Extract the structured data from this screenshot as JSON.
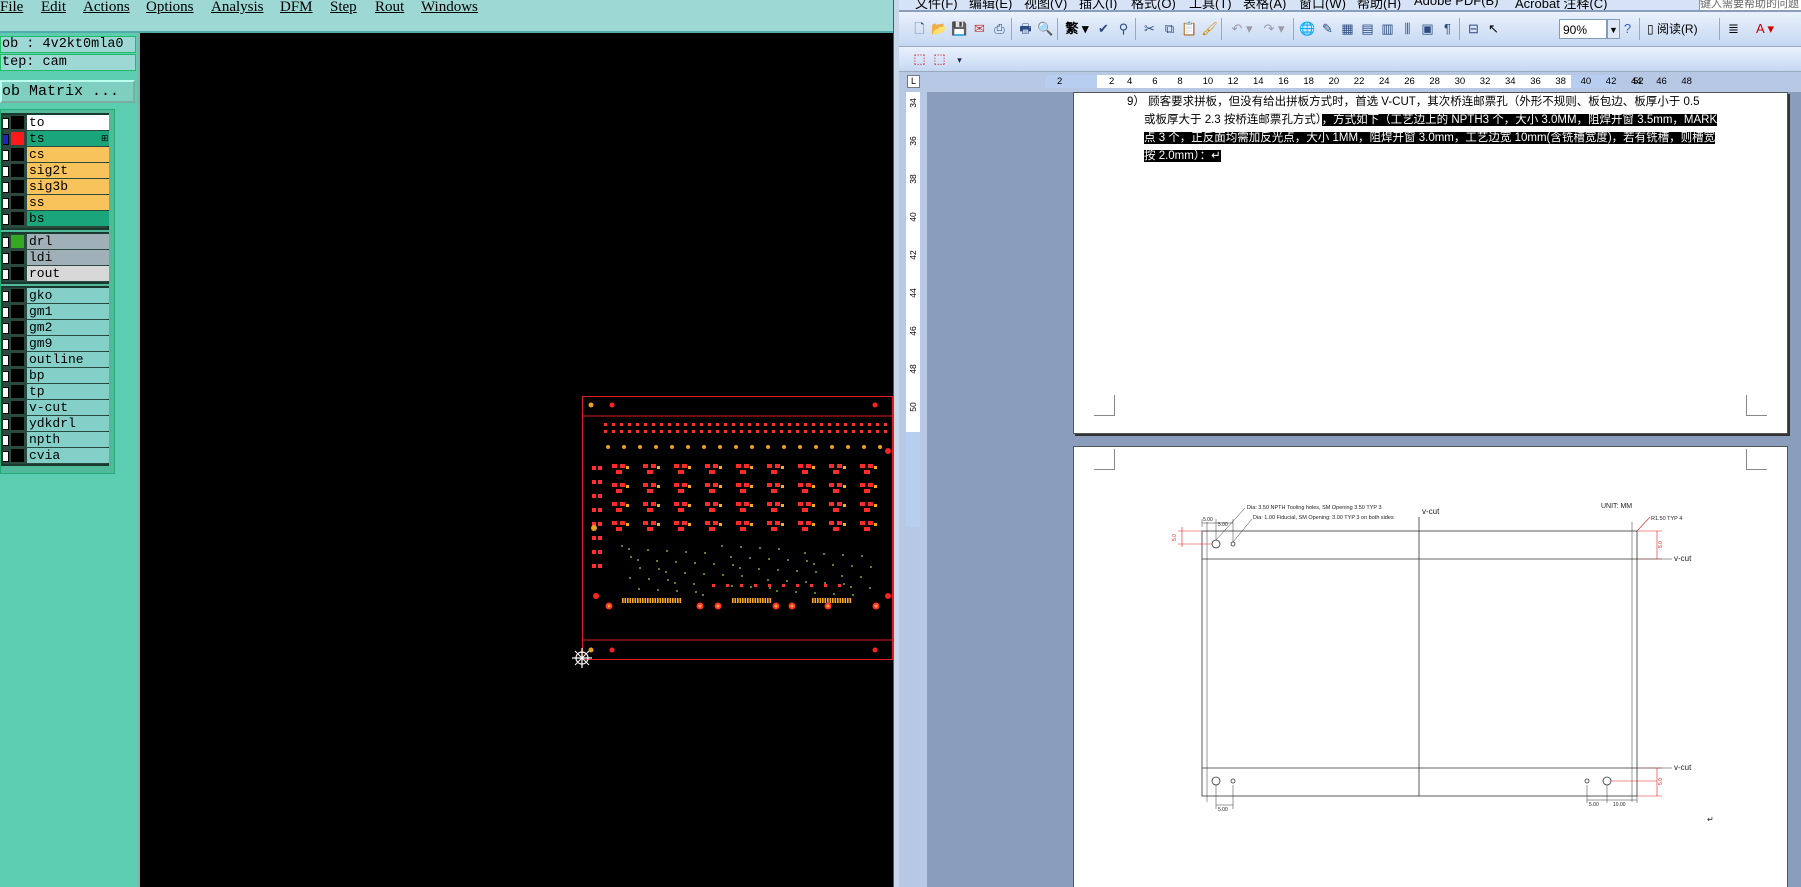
{
  "cam": {
    "menu": [
      "File",
      "Edit",
      "Actions",
      "Options",
      "Analysis",
      "DFM",
      "Step",
      "Rout",
      "Windows"
    ],
    "job_label": "ob : 4v2kt0mla0",
    "step_label": "tep: cam",
    "matrix_button": "ob Matrix ...",
    "layers": [
      {
        "name": "to",
        "color": "#ffffff",
        "swatch": "#000000",
        "selected": false
      },
      {
        "name": "ts",
        "color": "#1aa57a",
        "swatch": "#ff1a1a",
        "selected": true
      },
      {
        "name": "cs",
        "color": "#f7c35a",
        "swatch": "#000000",
        "selected": false
      },
      {
        "name": "sig2t",
        "color": "#f7c35a",
        "swatch": "#000000",
        "selected": false
      },
      {
        "name": "sig3b",
        "color": "#f7c35a",
        "swatch": "#000000",
        "selected": false
      },
      {
        "name": "ss",
        "color": "#f7c35a",
        "swatch": "#000000",
        "selected": false
      },
      {
        "name": "bs",
        "color": "#1aa57a",
        "swatch": "#000000",
        "selected": false
      },
      {
        "name": "drl",
        "color": "#a0b0b8",
        "swatch": "#33aa22",
        "selected": false
      },
      {
        "name": "ldi",
        "color": "#a0b0b8",
        "swatch": "#000000",
        "selected": false
      },
      {
        "name": "rout",
        "color": "#d8d8d8",
        "swatch": "#000000",
        "selected": false
      },
      {
        "name": "gko",
        "color": "#84d0c8",
        "swatch": "#000000",
        "selected": false
      },
      {
        "name": "gm1",
        "color": "#84d0c8",
        "swatch": "#000000",
        "selected": false
      },
      {
        "name": "gm2",
        "color": "#84d0c8",
        "swatch": "#000000",
        "selected": false
      },
      {
        "name": "gm9",
        "color": "#84d0c8",
        "swatch": "#000000",
        "selected": false
      },
      {
        "name": "outline",
        "color": "#84d0c8",
        "swatch": "#000000",
        "selected": false
      },
      {
        "name": "bp",
        "color": "#84d0c8",
        "swatch": "#000000",
        "selected": false
      },
      {
        "name": "tp",
        "color": "#84d0c8",
        "swatch": "#000000",
        "selected": false
      },
      {
        "name": "v-cut",
        "color": "#84d0c8",
        "swatch": "#000000",
        "selected": false
      },
      {
        "name": "ydkdrl",
        "color": "#84d0c8",
        "swatch": "#000000",
        "selected": false
      },
      {
        "name": "npth",
        "color": "#84d0c8",
        "swatch": "#000000",
        "selected": false
      },
      {
        "name": "cvia",
        "color": "#84d0c8",
        "swatch": "#000000",
        "selected": false
      }
    ]
  },
  "word": {
    "menu": [
      "文件(F)",
      "编辑(E)",
      "视图(V)",
      "插入(I)",
      "格式(O)",
      "工具(T)",
      "表格(A)",
      "窗口(W)",
      "帮助(H)",
      "Adobe PDF(B)",
      "Acrobat 注释(C)"
    ],
    "search_placeholder": "键入需要帮助的问题",
    "zoom": "90%",
    "read_button": "阅读(R)",
    "ruler_h": [
      "2",
      "2",
      "4",
      "6",
      "8",
      "10",
      "12",
      "14",
      "16",
      "18",
      "20",
      "22",
      "24",
      "26",
      "28",
      "30",
      "32",
      "34",
      "36",
      "38",
      "40",
      "42",
      "44",
      "46",
      "48",
      "52"
    ],
    "ruler_v": [
      "34",
      "36",
      "38",
      "40",
      "42",
      "44",
      "46",
      "48",
      "50"
    ],
    "page1": {
      "line1": "9） 顾客要求拼板，但没有给出拼板方式时，首选 V-CUT，其次桥连邮票孔（外形不规则、板包边、板厚小于 0.5",
      "line2_a": "或板厚大于 2.3 按桥连邮票孔方式）",
      "line2_b": "，方式如下（工艺边上的 NPTH3 个，大小 3.0MM，阻焊开窗 3.5mm，MARK",
      "line3": "点 3 个，正反面均需加反光点，大小 1MM，阻焊开窗 3.0mm，工艺边宽 10mm(含铣槽宽度)，若有铣槽，则槽宽",
      "line4": "按 2.0mm）：↵"
    },
    "drawing": {
      "note1": "Dia: 3.50 NPTH Tooling holes, SM Opening 3.50 TYP 3",
      "note2": "Dia: 1.00 Fiducial, SM Opening: 3.00 TYP 3 on both sides",
      "unit": "UNIT: MM",
      "radius": "R1.50 TYP 4",
      "vcut_top": "v-cut",
      "vcut_right_top": "v-cut",
      "vcut_right_bottom": "v-cut",
      "dim_5_top1": "5.00",
      "dim_5_top2": "5.00",
      "dim_5_left": "5.0",
      "dim_5_right_top": "5.0",
      "dim_5_right_bottom": "5.0",
      "dim_5_bottom_left": "5.00",
      "dim_5_bottom_right": "5.00",
      "dim_10_bottom_right": "10.00",
      "para_mark": "↵"
    }
  }
}
